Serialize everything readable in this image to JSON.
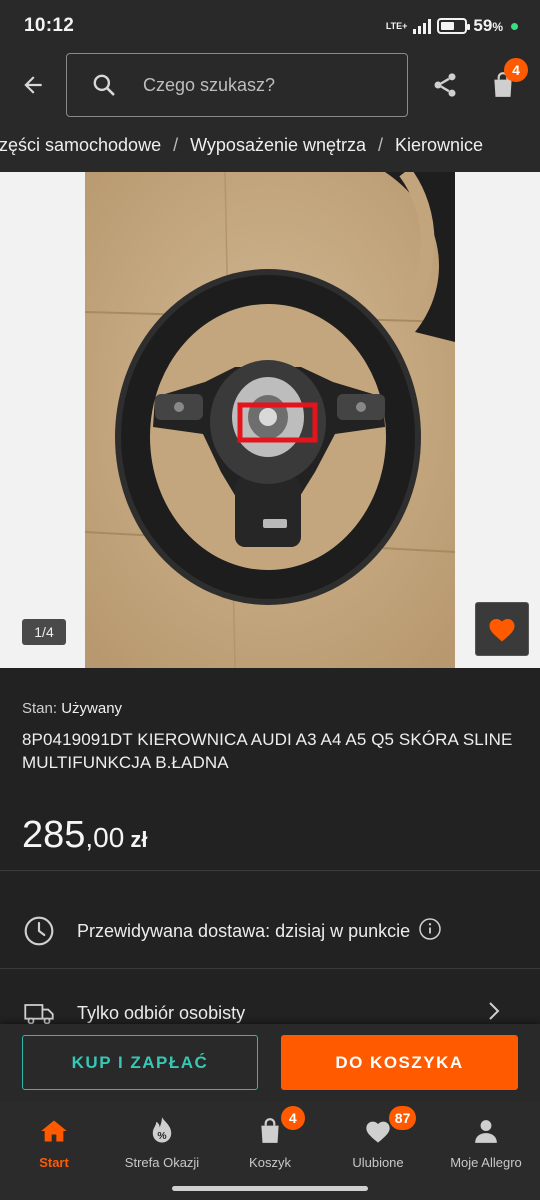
{
  "status_bar": {
    "time": "10:12",
    "network": "LTE+",
    "battery_percent": "59",
    "battery_level": 0.59
  },
  "header": {
    "search_placeholder": "Czego szukasz?",
    "cart_count": "4"
  },
  "breadcrumb": {
    "items": [
      "Części samochodowe",
      "Wyposażenie wnętrza",
      "Kierownice"
    ],
    "separator": "/"
  },
  "gallery": {
    "counter": "1/4",
    "image_description": "steering-wheel-photo"
  },
  "product": {
    "state_label": "Stan:",
    "state_value": "Używany",
    "title": "8P0419091DT KIEROWNICA AUDI A3 A4 A5 Q5 SKÓRA SLINE MULTIFUNKCJA B.ŁADNA",
    "price_int": "285",
    "price_dec": ",00",
    "price_currency": "zł"
  },
  "delivery": {
    "estimate_text": "Przewidywana dostawa: dzisiaj w punkcie",
    "pickup_text": "Tylko odbiór osobisty"
  },
  "actions": {
    "buy_label": "KUP I ZAPŁAĆ",
    "add_to_cart_label": "DO KOSZYKA"
  },
  "bottom_nav": {
    "items": [
      {
        "label": "Start",
        "icon": "home-icon",
        "active": true
      },
      {
        "label": "Strefa Okazji",
        "icon": "deals-icon"
      },
      {
        "label": "Koszyk",
        "icon": "cart-icon",
        "badge": "4"
      },
      {
        "label": "Ulubione",
        "icon": "heart-icon",
        "badge": "87"
      },
      {
        "label": "Moje Allegro",
        "icon": "user-icon"
      }
    ]
  },
  "colors": {
    "accent": "#ff5a00",
    "teal": "#2eb8a8",
    "background": "#222222"
  }
}
